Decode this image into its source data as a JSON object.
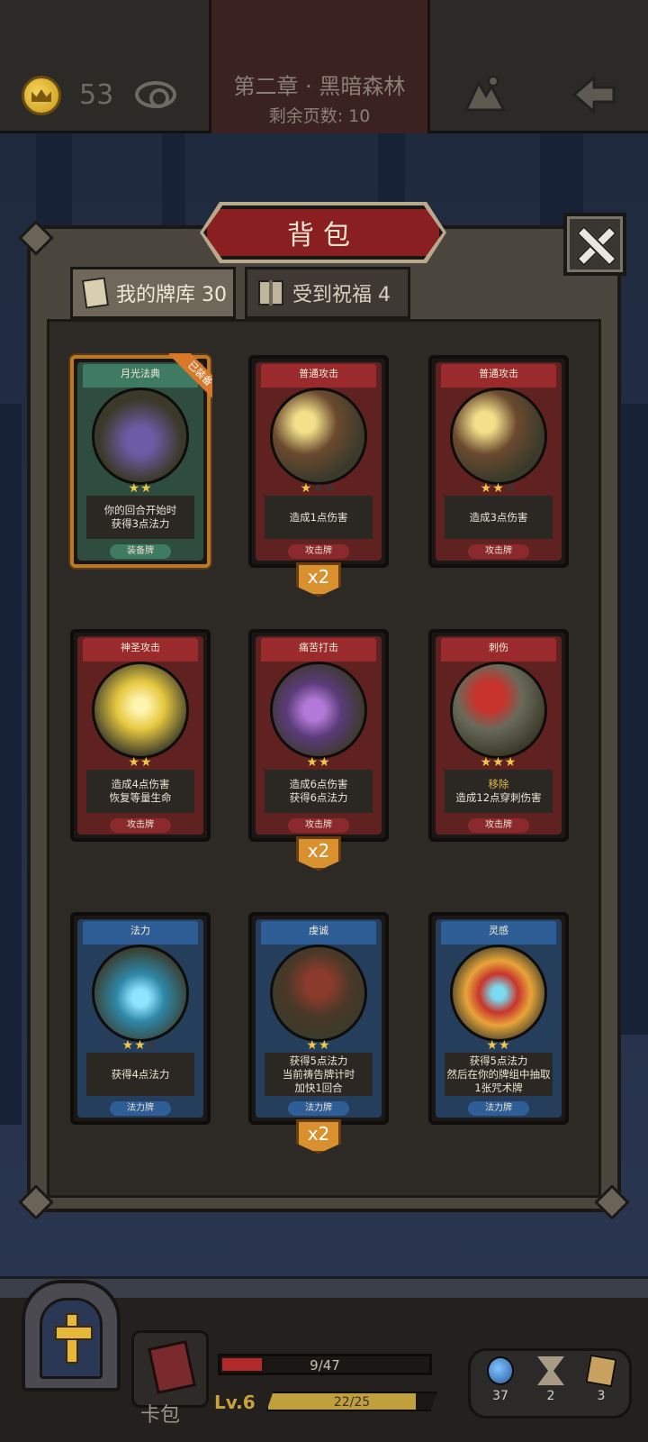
{
  "topbar": {
    "coins": "53",
    "chapter_title": "第二章 · 黑暗森林",
    "pages_left": "剩余页数: 10"
  },
  "bag": {
    "title": "背包",
    "tabs": [
      {
        "label": "我的牌库 30",
        "active": true
      },
      {
        "label": "受到祝福 4",
        "active": false
      }
    ]
  },
  "cards": [
    {
      "name": "月光法典",
      "color": "green",
      "stars": 2,
      "max_stars": 2,
      "desc": [
        "你的回合开始时",
        "获得3点法力"
      ],
      "type": "装备牌",
      "badge": "已装备",
      "art": "purple-tome-icon"
    },
    {
      "name": "普通攻击",
      "color": "red",
      "stars": 1,
      "max_stars": 3,
      "desc": [
        "造成1点伤害"
      ],
      "type": "攻击牌",
      "count": "x2",
      "art": "spell-book-icon"
    },
    {
      "name": "普通攻击",
      "color": "red",
      "stars": 2,
      "max_stars": 3,
      "desc": [
        "造成3点伤害"
      ],
      "type": "攻击牌",
      "art": "spell-book-icon"
    },
    {
      "name": "神圣攻击",
      "color": "red",
      "stars": 2,
      "max_stars": 2,
      "desc": [
        "造成4点伤害",
        "恢复等量生命"
      ],
      "type": "攻击牌",
      "art": "holy-light-icon"
    },
    {
      "name": "痛苦打击",
      "color": "red",
      "stars": 2,
      "max_stars": 2,
      "desc": [
        "造成6点伤害",
        "获得6点法力"
      ],
      "type": "攻击牌",
      "count": "x2",
      "art": "purple-skull-icon"
    },
    {
      "name": "刺伤",
      "color": "red",
      "stars": 3,
      "max_stars": 3,
      "desc": [
        "移除",
        "造成12点穿刺伤害"
      ],
      "highlight_first": true,
      "type": "攻击牌",
      "art": "dagger-icon"
    },
    {
      "name": "法力",
      "color": "blue",
      "stars": 2,
      "max_stars": 3,
      "desc": [
        "获得4点法力"
      ],
      "type": "法力牌",
      "art": "mana-orb-icon"
    },
    {
      "name": "虔诚",
      "color": "blue",
      "stars": 2,
      "max_stars": 2,
      "desc": [
        "获得5点法力",
        "当前祷告牌计时",
        "加快1回合"
      ],
      "type": "法力牌",
      "count": "x2",
      "art": "hooded-monk-icon"
    },
    {
      "name": "灵感",
      "color": "blue",
      "stars": 2,
      "max_stars": 2,
      "desc": [
        "获得5点法力",
        "然后在你的牌组中抽取",
        "1张咒术牌"
      ],
      "type": "法力牌",
      "art": "burning-skull-icon"
    }
  ],
  "hud": {
    "deck_label": "卡包",
    "hp_text": "9/47",
    "hp_fraction": 0.19,
    "level": "Lv.6",
    "xp_text": "22/25",
    "xp_fraction": 0.88,
    "stats": [
      {
        "icon": "potion-icon",
        "value": "37"
      },
      {
        "icon": "hourglass-icon",
        "value": "2"
      },
      {
        "icon": "cards-icon",
        "value": "3"
      }
    ]
  },
  "colors": {
    "red_card": "#9b2a2c",
    "blue_card": "#2f5e96",
    "green_card": "#3f7a62",
    "banner": "#8a1f22",
    "gold": "#f0c848"
  }
}
